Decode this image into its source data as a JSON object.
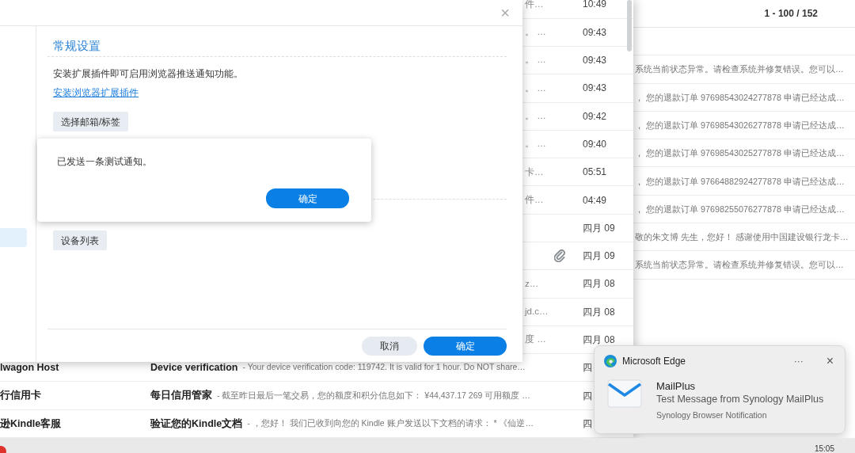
{
  "background_list": {
    "pagination": "1 - 100 / 152",
    "previews": [
      "系统当前状态异常。请检查系统并修复错误。您可以…",
      "， 您的退款订单 97698543024277878 申请已经达成…",
      "， 您的退款订单 97698543026277878 申请已经达成…",
      "， 您的退款订单 97698543025277878 申请已经达成…",
      "， 您的退款订单 97664882924277878 申请已经达成…",
      "， 您的退款订单 97698255076277878 申请已经达成…",
      "敬的朱文博 先生，您好！ 感谢使用中国建设银行龙卡…",
      "系统当前状态异常。请检查系统并修复错误。您可以…"
    ]
  },
  "mail_list": {
    "rows": [
      {
        "snippet": "件…",
        "date": "10:49",
        "attachment": false
      },
      {
        "snippet": "。 …",
        "date": "09:43",
        "attachment": false
      },
      {
        "snippet": "。 …",
        "date": "09:43",
        "attachment": false
      },
      {
        "snippet": "。 …",
        "date": "09:43",
        "attachment": false
      },
      {
        "snippet": "。 …",
        "date": "09:42",
        "attachment": false
      },
      {
        "snippet": "。 …",
        "date": "09:40",
        "attachment": false
      },
      {
        "snippet": "卡…",
        "date": "05:51",
        "attachment": false
      },
      {
        "snippet": "件…",
        "date": "04:49",
        "attachment": false
      },
      {
        "date": "四月 09",
        "attachment": false
      },
      {
        "date": "四月 09",
        "attachment": true
      },
      {
        "snippet": "z…",
        "date": "四月 08",
        "attachment": false
      },
      {
        "snippet": "jd.c…",
        "date": "四月 08",
        "attachment": false
      },
      {
        "snippet": "度 …",
        "date": "四月 08",
        "attachment": false
      },
      {
        "sender": "lwagon Host",
        "subject": "Device verification",
        "preview": "- Your device verification code: 119742. It is valid for 1 hour. Do NOT share…",
        "date": "四",
        "attachment": false
      },
      {
        "sender": "行信用卡",
        "subject": "每日信用管家",
        "preview": "- 截至昨日最后一笔交易，您的额度和积分信息如下： ¥44,437.17 269 可用额度 …",
        "date": "四",
        "attachment": false
      },
      {
        "sender": "逊Kindle客服",
        "subject": "验证您的Kindle文档",
        "preview": "- ，您好！ 我们已收到向您的 Kindle 账户发送以下文档的请求： * 《仙逆…",
        "date": "四",
        "attachment": false
      }
    ]
  },
  "settings_dialog": {
    "close": "×",
    "sidebar": {
      "items": [
        {
          "selected": true
        }
      ]
    },
    "title": "常规设置",
    "description": "安装扩展插件即可启用浏览器推送通知功能。",
    "link": "安装浏览器扩展插件",
    "buttons": [
      "选择邮箱/标签",
      "设备列表"
    ],
    "footer_buttons": [
      {
        "label": "取消",
        "kind": "secondary"
      },
      {
        "label": "确定",
        "kind": "primary"
      }
    ]
  },
  "alert": {
    "message": "已发送一条测试通知。",
    "button": "确定"
  },
  "notification": {
    "app": "Microsoft Edge",
    "more": "···",
    "close": "×",
    "title": "MailPlus",
    "message": "Test Message from Synology MailPlus",
    "source": "Synology Browser Notification"
  },
  "taskbar": {
    "time": "15:05"
  }
}
